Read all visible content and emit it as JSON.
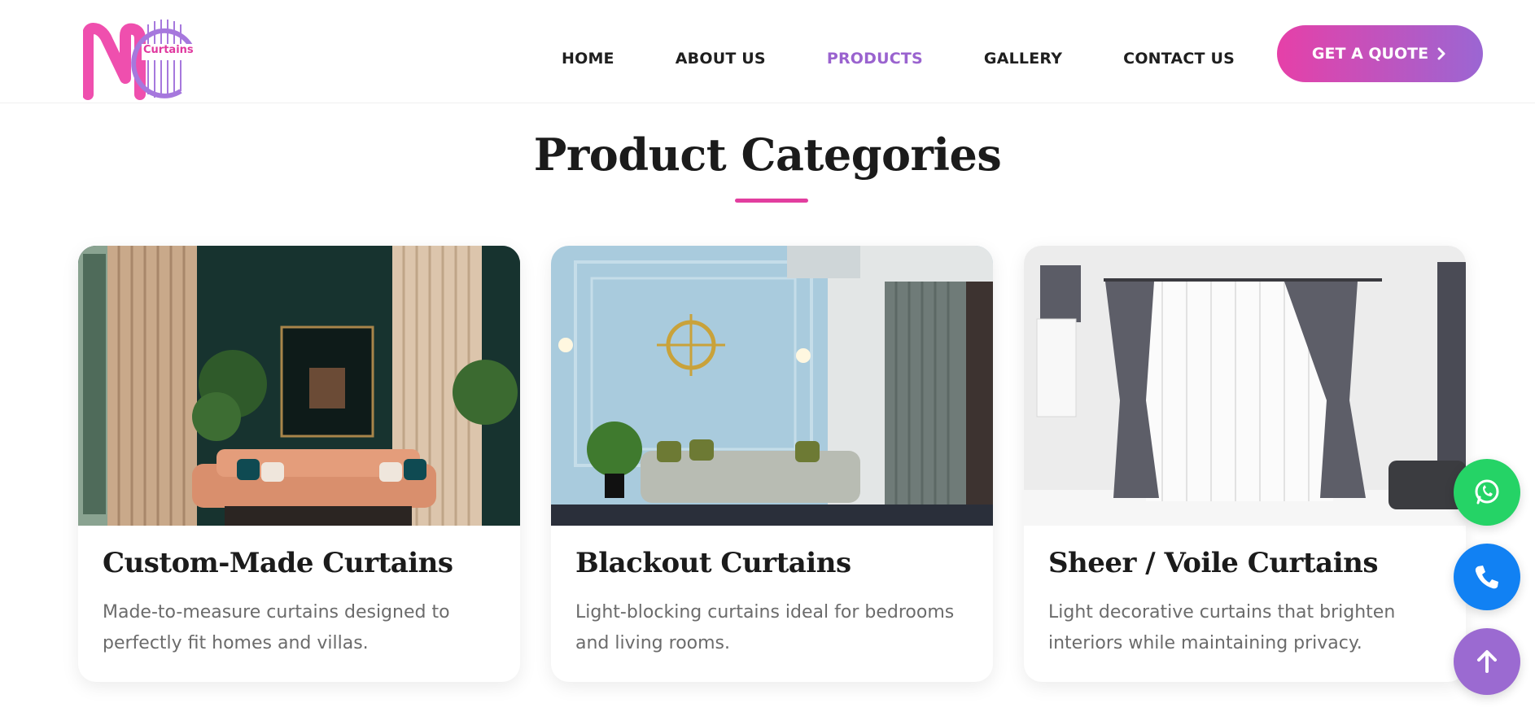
{
  "brand": {
    "logo_text": "Curtains",
    "colors": {
      "pink": "#e23e9f",
      "purple": "#9a63cf",
      "text": "#1b1b1b"
    }
  },
  "nav": {
    "items": [
      {
        "label": "HOME",
        "active": false
      },
      {
        "label": "ABOUT US",
        "active": false
      },
      {
        "label": "PRODUCTS",
        "active": true
      },
      {
        "label": "GALLERY",
        "active": false
      },
      {
        "label": "CONTACT US",
        "active": false
      }
    ],
    "cta_label": "GET A QUOTE",
    "cta_icon": "chevron-right-icon"
  },
  "section": {
    "title": "Product Categories"
  },
  "cards": [
    {
      "title": "Custom-Made Curtains",
      "description": "Made-to-measure curtains designed to perfectly fit homes and villas.",
      "image": "living-room-beige-curtains"
    },
    {
      "title": "Blackout Curtains",
      "description": "Light-blocking curtains ideal for bedrooms and living rooms.",
      "image": "blue-wall-living-room-grey-curtains"
    },
    {
      "title": "Sheer / Voile Curtains",
      "description": "Light decorative curtains that brighten interiors while maintaining privacy.",
      "image": "window-sheer-and-grey-curtains"
    }
  ],
  "floating_buttons": [
    {
      "name": "whatsapp",
      "icon": "whatsapp-icon",
      "color": "#25d366"
    },
    {
      "name": "phone",
      "icon": "phone-icon",
      "color": "#1181f3"
    },
    {
      "name": "scroll-top",
      "icon": "arrow-up-icon",
      "color": "#9b6ad1"
    }
  ]
}
